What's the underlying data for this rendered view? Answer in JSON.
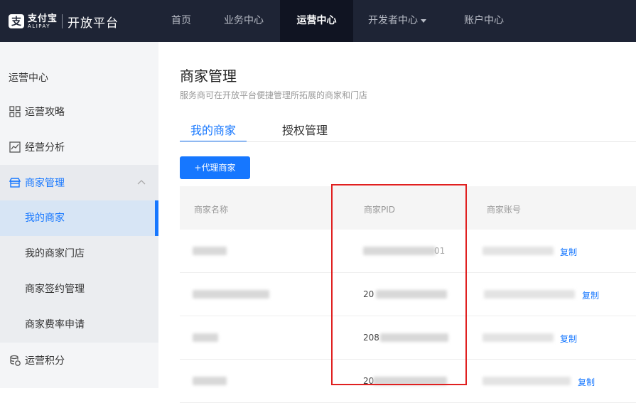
{
  "brand": {
    "cn": "支付宝",
    "en": "ALIPAY",
    "platform": "开放平台"
  },
  "nav": {
    "home": "首页",
    "biz": "业务中心",
    "ops": "运营中心",
    "dev": "开发者中心",
    "acct": "账户中心"
  },
  "sidebar": {
    "title": "运营中心",
    "items": {
      "guide": "运营攻略",
      "analysis": "经营分析",
      "merchant": "商家管理",
      "points": "运营积分"
    },
    "subs": {
      "my_merchants": "我的商家",
      "my_stores": "我的商家门店",
      "contract": "商家签约管理",
      "fee": "商家费率申请"
    }
  },
  "page": {
    "title": "商家管理",
    "subtitle": "服务商可在开放平台便捷管理所拓展的商家和门店"
  },
  "tabs": {
    "mine": "我的商家",
    "auth": "授权管理"
  },
  "toolbar": {
    "add_label": "+代理商家"
  },
  "table": {
    "headers": {
      "name": "商家名称",
      "pid": "商家PID",
      "account": "商家账号"
    },
    "rows": [
      {
        "pid_visible": "",
        "pid_tail": "01",
        "copy": "复制"
      },
      {
        "pid_visible": "20",
        "pid_tail": "",
        "copy": "复制"
      },
      {
        "pid_visible": "208",
        "pid_tail": "",
        "copy": "复制"
      },
      {
        "pid_visible": "20",
        "pid_tail": "",
        "copy": "复制"
      }
    ]
  },
  "colors": {
    "accent": "#1677ff",
    "topbar": "#1e2435",
    "highlight": "#e02020"
  }
}
